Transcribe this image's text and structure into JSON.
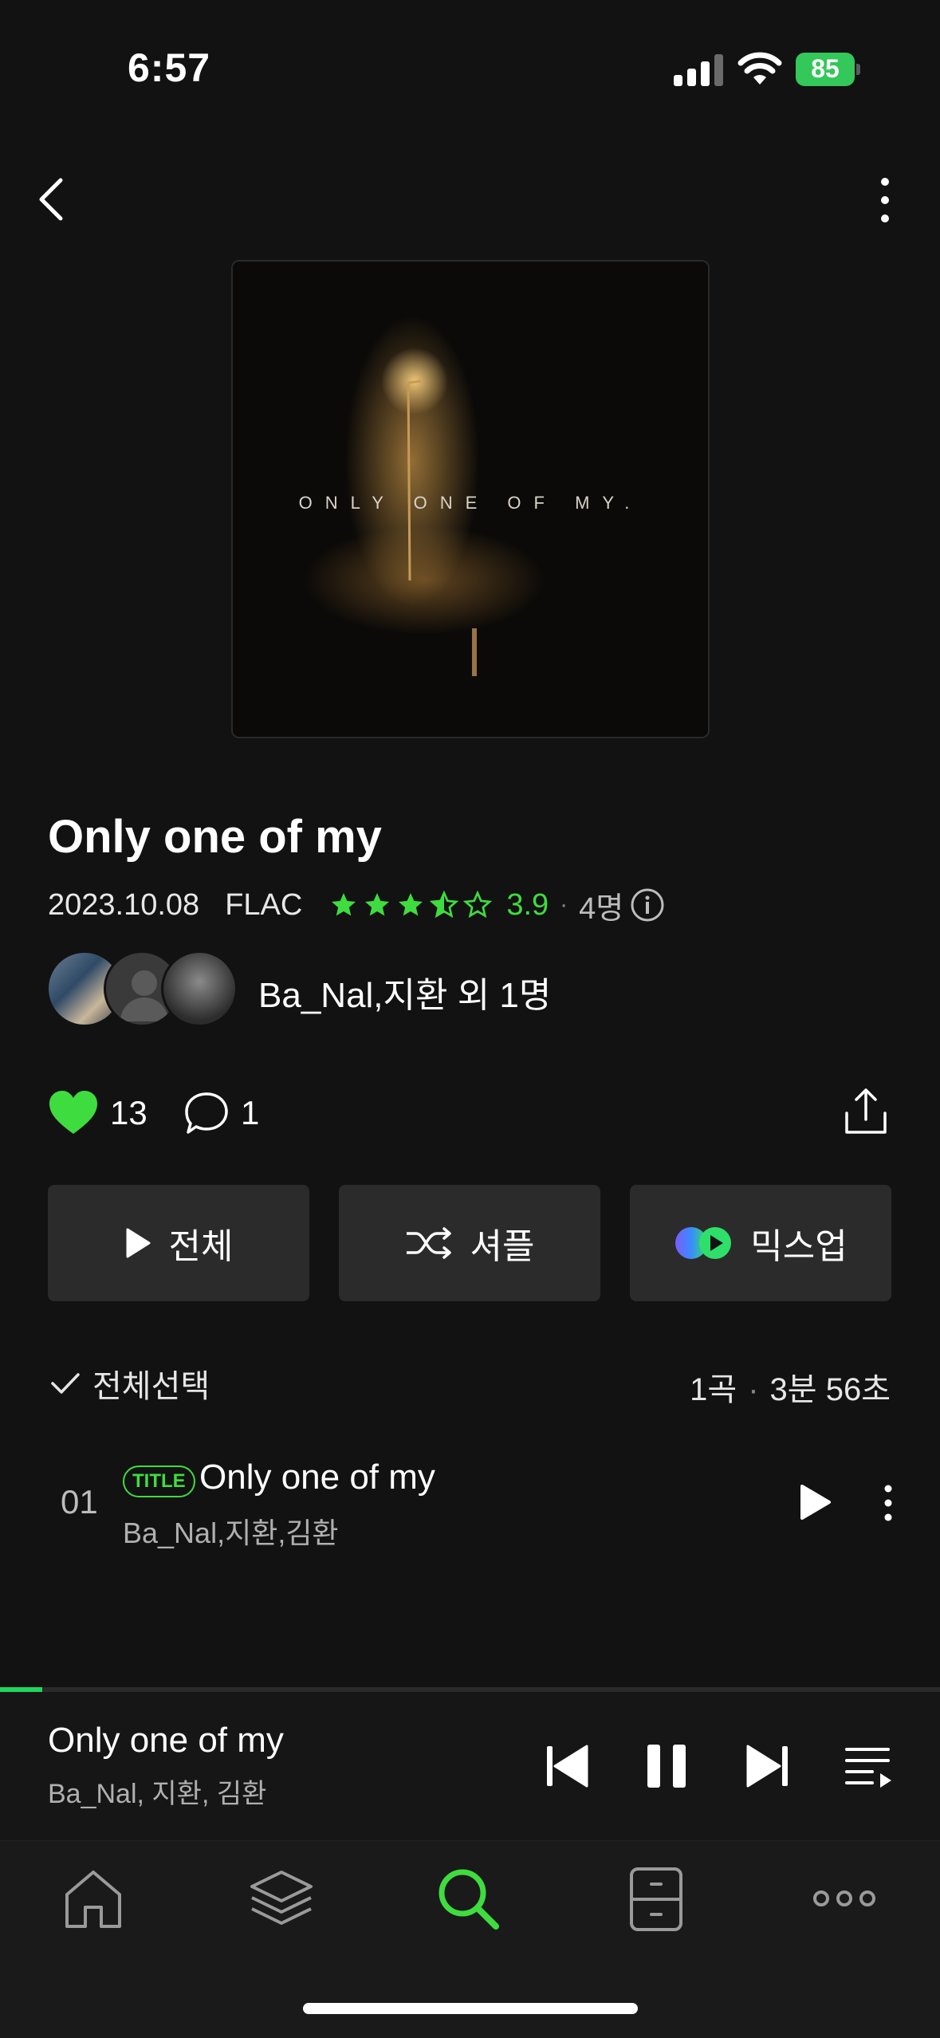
{
  "status_bar": {
    "time": "6:57",
    "battery": "85"
  },
  "album": {
    "cover_text": "ONLY ONE OF MY.",
    "title": "Only one of my",
    "release_date": "2023.10.08",
    "format": "FLAC",
    "rating": "3.9",
    "rating_separator": "·",
    "rating_count": "4명",
    "artists_text": "Ba_Nal,지환 외 1명"
  },
  "social": {
    "likes": "13",
    "comments": "1"
  },
  "buttons": {
    "play_all": "전체",
    "shuffle": "셔플",
    "mixup": "믹스업"
  },
  "list_header": {
    "select_all": "전체선택",
    "track_count": "1곡",
    "separator": "·",
    "duration": "3분 56초"
  },
  "tracks": [
    {
      "number": "01",
      "badge": "TITLE",
      "title": "Only one of my",
      "artists": "Ba_Nal,지환,김환"
    }
  ],
  "now_playing": {
    "title": "Only one of my",
    "artists": "Ba_Nal, 지환, 김환",
    "progress": 0.045
  },
  "tab_bar": {
    "items": [
      {
        "icon": "home-icon"
      },
      {
        "icon": "layers-icon"
      },
      {
        "icon": "search-icon",
        "active": true
      },
      {
        "icon": "cabinet-icon"
      },
      {
        "icon": "more-dots-icon"
      }
    ]
  },
  "colors": {
    "accent": "#3fdc3f",
    "background": "#121212",
    "button": "#2b2b2b"
  }
}
